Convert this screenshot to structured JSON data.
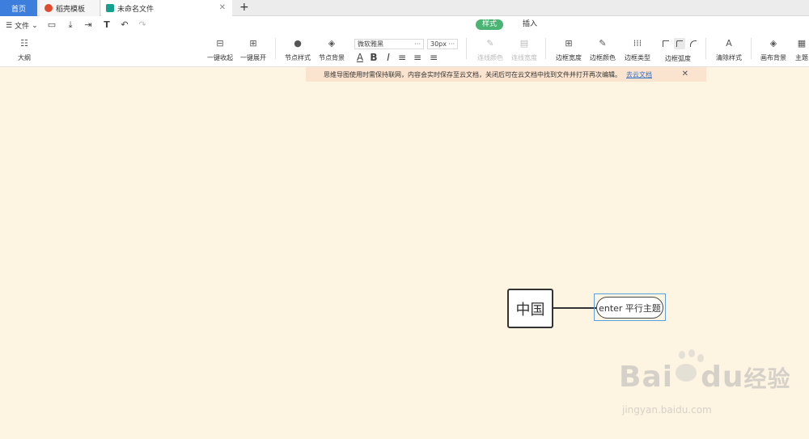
{
  "tabs": {
    "home": "首页",
    "templates": "稻壳模板",
    "document": "未命名文件",
    "new_tab": "+"
  },
  "menu": {
    "file": "文件"
  },
  "ribbon_tabs": {
    "style": "样式",
    "insert": "插入"
  },
  "tools": {
    "outline": "大纲",
    "collapse_all": "一键收起",
    "expand_all": "一键展开",
    "node_style": "节点样式",
    "node_background": "节点背景",
    "font_name": "微软雅黑",
    "font_size": "30px",
    "line_color": "连线颜色",
    "line_width": "连线宽度",
    "border_width": "边框宽度",
    "border_color": "边框颜色",
    "border_type": "边框类型",
    "border_radius": "边框弧度",
    "clear_style": "清除样式",
    "canvas_background": "画布背景",
    "theme": "主题"
  },
  "notice": {
    "text": "思维导图使用时需保持联网，内容会实时保存至云文档，关闭后可在云文档中找到文件并打开再次编辑。",
    "link": "去云文档"
  },
  "canvas": {
    "root_topic": "中国",
    "sub_topic": "enter 平行主题"
  },
  "watermark": {
    "brand": "Bai",
    "brand2": "du",
    "brand_cn": "经验",
    "url": "jingyan.baidu.com"
  },
  "colors": {
    "canvas_bg": "#fdf4e2",
    "accent_green": "#4bb373",
    "home_tab_blue": "#3d7ddb",
    "notice_bg": "#fbe4cf"
  }
}
